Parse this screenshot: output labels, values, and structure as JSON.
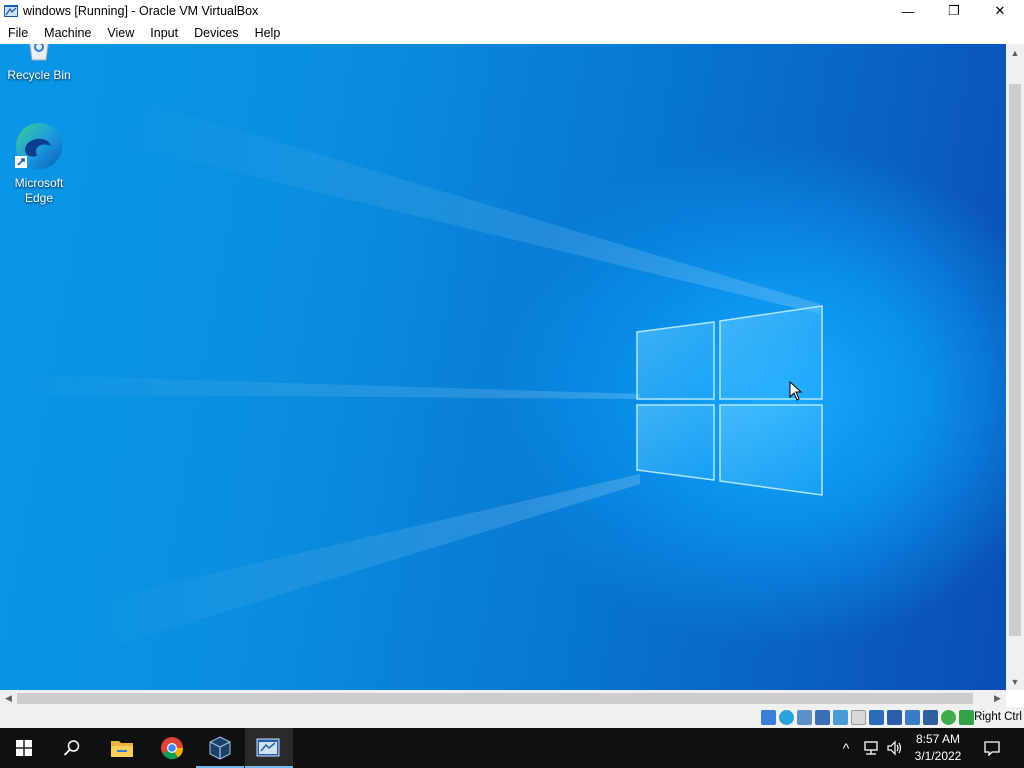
{
  "window": {
    "title": "windows [Running] - Oracle VM VirtualBox",
    "minimize_glyph": "—",
    "maximize_glyph": "❐",
    "close_glyph": "✕"
  },
  "menu": {
    "items": [
      {
        "label": "File"
      },
      {
        "label": "Machine"
      },
      {
        "label": "View"
      },
      {
        "label": "Input"
      },
      {
        "label": "Devices"
      },
      {
        "label": "Help"
      }
    ]
  },
  "desktop": {
    "icons": [
      {
        "label": "Recycle Bin",
        "icon": "recycle-bin-icon"
      },
      {
        "label": "Microsoft Edge",
        "icon": "edge-icon"
      }
    ],
    "colors": {
      "wallpaper_light": "#1aa8ff",
      "wallpaper_dark": "#0a4db5"
    }
  },
  "scrollbars": {
    "up": "▲",
    "down": "▼",
    "left": "◀",
    "right": "▶"
  },
  "statusbar": {
    "host_key": "Right Ctrl",
    "indicators": [
      "hard-disk-icon",
      "optical-drive-icon",
      "audio-icon",
      "network-icon",
      "usb-icon",
      "shared-folders-icon",
      "display-icon",
      "video-capture-icon",
      "recording-icon",
      "vt-x-icon",
      "guest-additions-icon",
      "mouse-integration-icon"
    ]
  },
  "taskbar": {
    "apps": [
      "start-icon",
      "search-icon",
      "file-explorer-icon",
      "chrome-icon",
      "virtualbox-icon",
      "vm-window-icon"
    ],
    "clock": {
      "time": "8:57 AM",
      "date": "3/1/2022"
    },
    "tray": {
      "chevron": "^"
    }
  }
}
